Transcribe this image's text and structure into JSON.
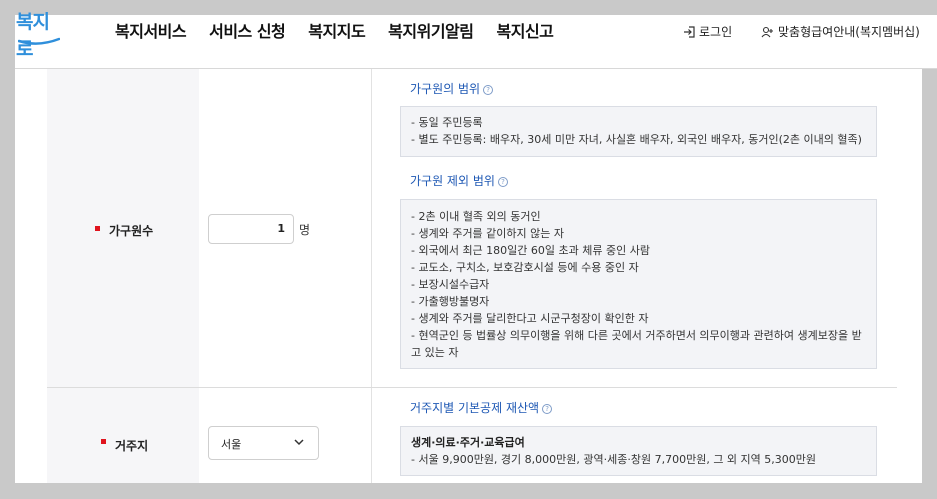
{
  "header": {
    "logo_text": "복지로",
    "nav": [
      "복지서비스",
      "서비스 신청",
      "복지지도",
      "복지위기알림",
      "복지신고"
    ],
    "login_label": "로그인",
    "member_label": "맞춤형급여안내(복지멤버십)"
  },
  "rows": [
    {
      "label": "가구원수",
      "input_value": "1",
      "unit": "명",
      "sections": [
        {
          "title": "가구원의 범위",
          "items": [
            "- 동일 주민등록",
            "- 별도 주민등록: 배우자, 30세 미만 자녀, 사실혼 배우자, 외국인 배우자, 동거인(2촌 이내의 혈족)"
          ]
        },
        {
          "title": "가구원 제외 범위",
          "items": [
            "- 2촌 이내 혈족 외의 동거인",
            "- 생계와 주거를 같이하지 않는 자",
            "- 외국에서 최근 180일간 60일 초과 체류 중인 사람",
            "- 교도소, 구치소, 보호감호시설 등에 수용 중인 자",
            "- 보장시설수급자",
            "- 가출행방불명자",
            "- 생계와 주거를 달리한다고 시군구청장이 확인한 자",
            "- 현역군인 등 법률상 의무이행을 위해 다른 곳에서 거주하면서 의무이행과 관련하여 생계보장을 받고 있는 자"
          ]
        }
      ]
    },
    {
      "label": "거주지",
      "select_value": "서울",
      "sections": [
        {
          "title": "거주지별 기본공제 재산액",
          "heading": "생계·의료·주거·교육급여",
          "items": [
            "- 서울 9,900만원, 경기 8,000만원, 광역·세종·창원 7,700만원, 그 외 지역 5,300만원"
          ]
        }
      ]
    }
  ],
  "colors": {
    "accent": "#1e58b4",
    "required_mark": "#e0141e",
    "logo": "#2f8fdb"
  },
  "icons": {
    "login": "login-arrow-icon",
    "member": "person-plus-icon",
    "help": "question-circle-icon",
    "select": "chevron-down-icon"
  }
}
